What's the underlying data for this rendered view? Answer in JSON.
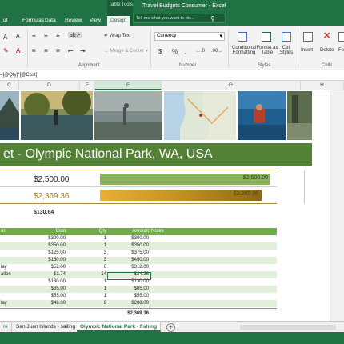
{
  "titlebar": {
    "context_label": "Table Tools",
    "window_title": "Travel Budgets Consumer - Excel",
    "tabs": [
      "ut",
      "Formulas",
      "Data",
      "Review",
      "View",
      "Design"
    ],
    "active_tab": "Design",
    "tell_me_placeholder": "Tell me what you want to do..."
  },
  "ribbon": {
    "wrap_text": "Wrap Text",
    "merge_center": "Merge & Center",
    "number_format": "Currency",
    "currency_symbol": "$",
    "percent": "%",
    "comma": ",",
    "conditional_formatting": [
      "Conditional",
      "Formatting"
    ],
    "format_as_table": [
      "Format as",
      "Table"
    ],
    "cell_styles": [
      "Cell",
      "Styles"
    ],
    "insert": "Insert",
    "delete": "Delete",
    "format": "Fo",
    "group_alignment": "Alignment",
    "group_number": "Number",
    "group_styles": "Styles",
    "group_cells": "Cells"
  },
  "formula_bar": {
    "text": "=[@Qty]*[@Cost]"
  },
  "columns": [
    "C",
    "D",
    "E",
    "F",
    "G",
    "H"
  ],
  "selected_column": "F",
  "banner_title": "et - Olympic National Park, WA, USA",
  "budget": {
    "planned": "$2,500.00",
    "actual": "$2,369.36",
    "planned_bar_label": "$2,500.00",
    "actual_bar_label": "$2,369.36",
    "difference": "$130.64",
    "planned_fraction": 1.0,
    "actual_fraction": 0.9477
  },
  "table": {
    "headers": [
      "on",
      "Cost",
      "Qty",
      "Amount",
      "Notes"
    ],
    "rows": [
      {
        "desc": "",
        "cost": "$300.00",
        "qty": "1",
        "amount": "$300.00"
      },
      {
        "desc": "",
        "cost": "$350.00",
        "qty": "1",
        "amount": "$350.00"
      },
      {
        "desc": "",
        "cost": "$125.00",
        "qty": "3",
        "amount": "$375.00"
      },
      {
        "desc": "",
        "cost": "$150.00",
        "qty": "3",
        "amount": "$450.00"
      },
      {
        "desc": "lay",
        "cost": "$52.00",
        "qty": "6",
        "amount": "$312.00"
      },
      {
        "desc": "allon",
        "cost": "$1.74",
        "qty": "14",
        "amount": "$24.36"
      },
      {
        "desc": "",
        "cost": "$130.00",
        "qty": "1",
        "amount": "$130.00"
      },
      {
        "desc": "",
        "cost": "$85.00",
        "qty": "1",
        "amount": "$85.00"
      },
      {
        "desc": "",
        "cost": "$55.00",
        "qty": "1",
        "amount": "$55.00"
      },
      {
        "desc": "lay",
        "cost": "$48.00",
        "qty": "6",
        "amount": "$288.00"
      }
    ],
    "total": "$2,369.36"
  },
  "sheet_tabs": {
    "partial": "re",
    "tab1": "San Juan Islands - sailing",
    "tab2": "Olympic National Park - fishing",
    "add": "+"
  },
  "colors": {
    "excel_green": "#217346",
    "banner_green": "#538135",
    "table_header": "#70ad47",
    "table_band": "#e2efda",
    "planned_bar": "#8bb35e",
    "actual_bar": "#c89422"
  }
}
